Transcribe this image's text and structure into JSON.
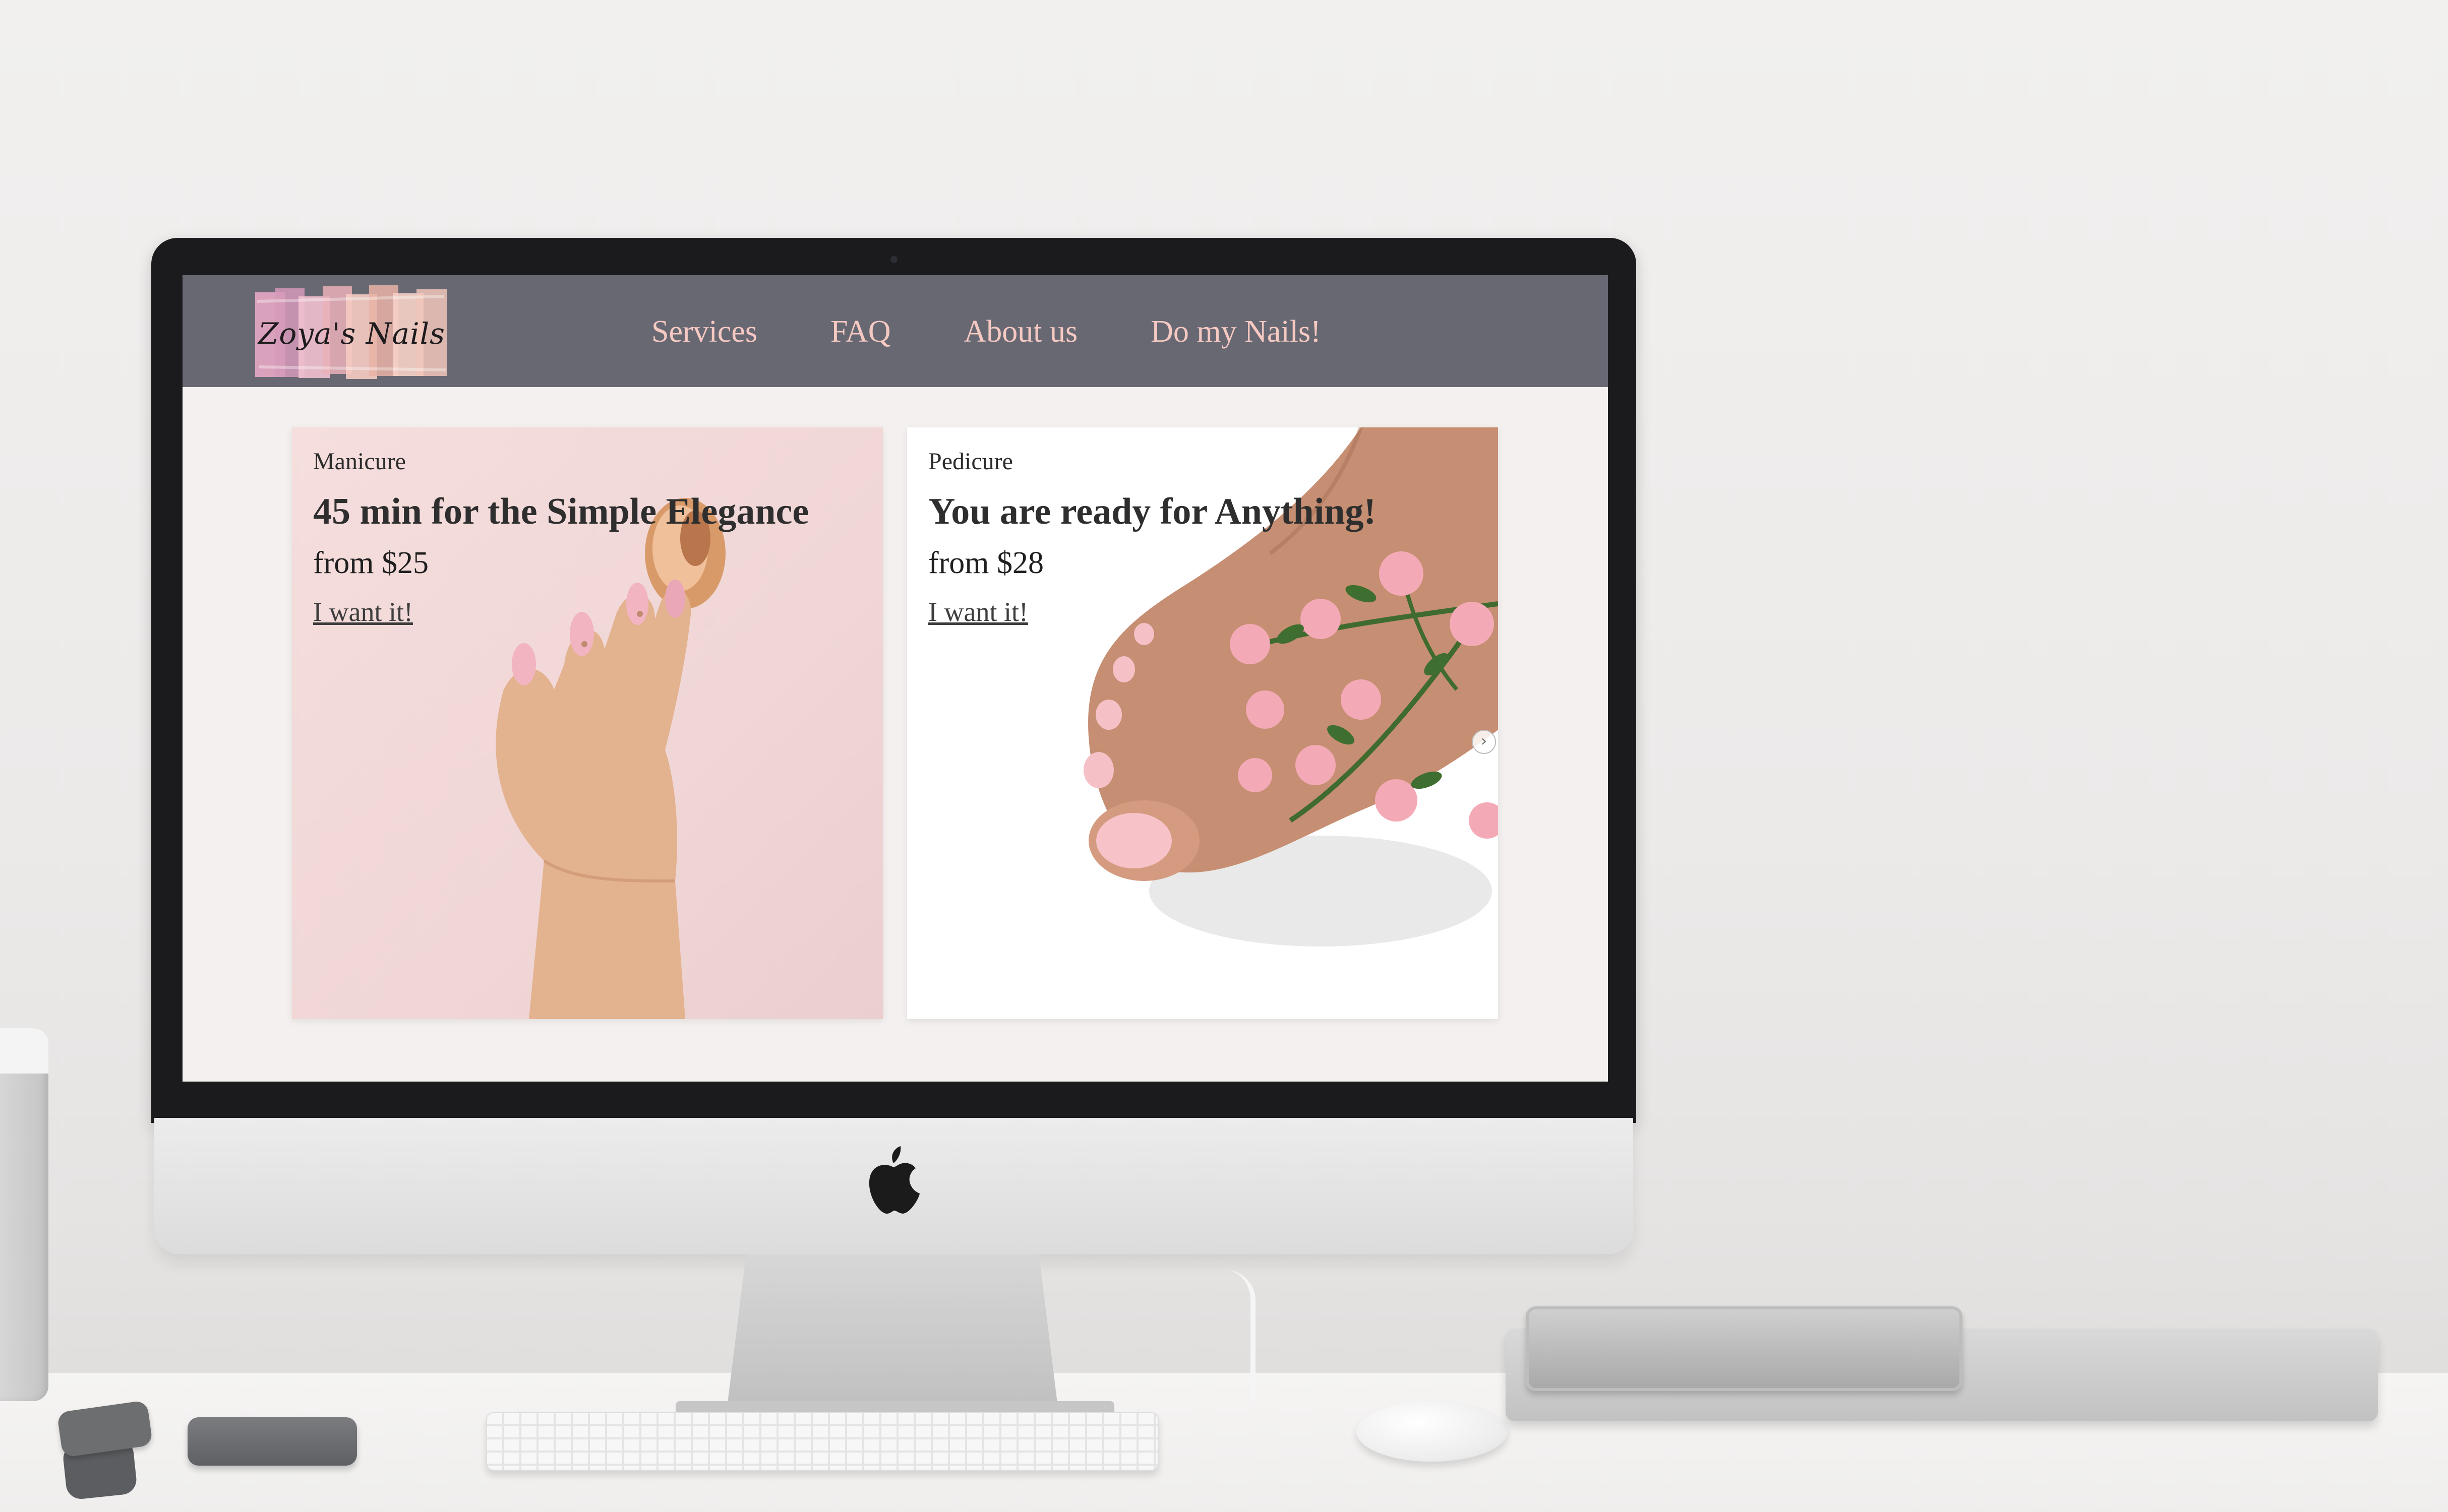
{
  "nav": {
    "logo_text": "Zoya's Nails",
    "links": [
      {
        "label": "Services"
      },
      {
        "label": "FAQ"
      },
      {
        "label": "About us"
      },
      {
        "label": "Do my Nails!"
      }
    ]
  },
  "cards": [
    {
      "category": "Manicure",
      "title": "45 min for the Simple Elegance",
      "price": "from $25",
      "cta": "I want it!"
    },
    {
      "category": "Pedicure",
      "title": "You are ready for Anything!",
      "price": "from $28",
      "cta": "I want it!"
    }
  ],
  "carousel": {
    "next_glyph": "›"
  },
  "colors": {
    "navbar": "#686873",
    "nav_link": "#f5c9c2",
    "page_bg": "#f4f0ef"
  }
}
